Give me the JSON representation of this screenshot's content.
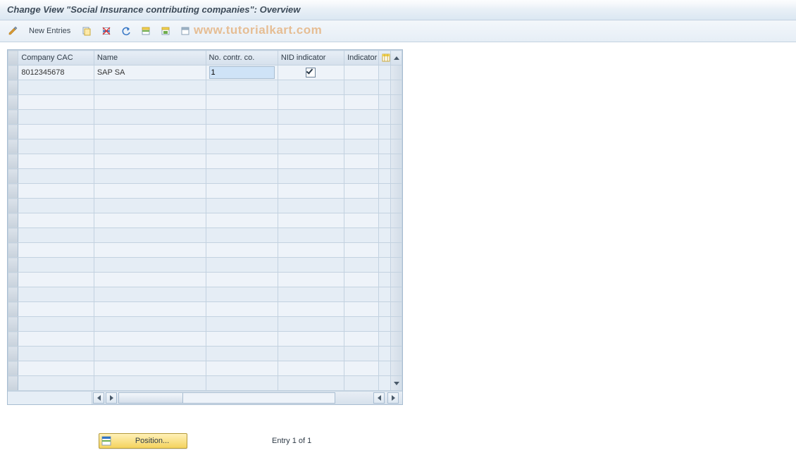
{
  "title": "Change View \"Social Insurance contributing companies\": Overview",
  "toolbar": {
    "new_entries_label": "New Entries"
  },
  "watermark": "www.tutorialkart.com",
  "grid": {
    "columns": {
      "cac": "Company CAC",
      "name": "Name",
      "no": "No. contr. co.",
      "nid": "NID indicator",
      "ind": "Indicator"
    },
    "rows": [
      {
        "cac": "8012345678",
        "name": "SAP SA",
        "no": "1",
        "nid": true,
        "ind": ""
      }
    ],
    "empty_row_count": 21
  },
  "footer": {
    "position_label": "Position...",
    "entry_text": "Entry 1 of 1"
  }
}
